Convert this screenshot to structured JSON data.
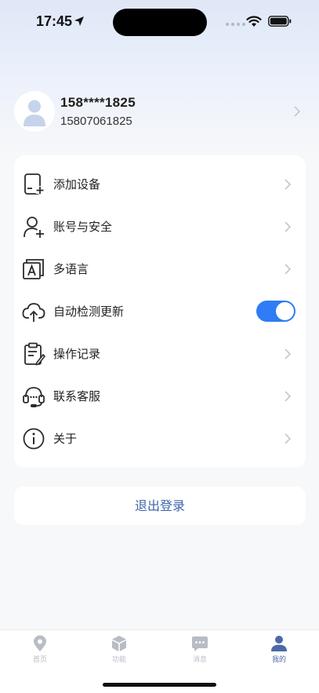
{
  "status_bar": {
    "time": "17:45"
  },
  "profile": {
    "name": "158****1825",
    "phone": "15807061825"
  },
  "menu": {
    "items": [
      {
        "label": "添加设备",
        "icon": "add-device-icon"
      },
      {
        "label": "账号与安全",
        "icon": "account-security-icon"
      },
      {
        "label": "多语言",
        "icon": "language-icon"
      },
      {
        "label": "自动检测更新",
        "icon": "cloud-upload-icon",
        "toggle_on": true
      },
      {
        "label": "操作记录",
        "icon": "clipboard-icon"
      },
      {
        "label": "联系客服",
        "icon": "headset-icon"
      },
      {
        "label": "关于",
        "icon": "info-icon"
      }
    ]
  },
  "logout_label": "退出登录",
  "tabbar": {
    "tabs": [
      {
        "label": "首页",
        "icon": "location-pin-icon"
      },
      {
        "label": "功能",
        "icon": "cube-icon"
      },
      {
        "label": "消息",
        "icon": "chat-icon"
      },
      {
        "label": "我的",
        "icon": "person-icon",
        "active": true
      }
    ]
  },
  "colors": {
    "accent": "#2e7cf6",
    "logout_text": "#3f65a8",
    "active_tab": "#4c6aa5",
    "inactive_tab": "#b8bcc4"
  }
}
